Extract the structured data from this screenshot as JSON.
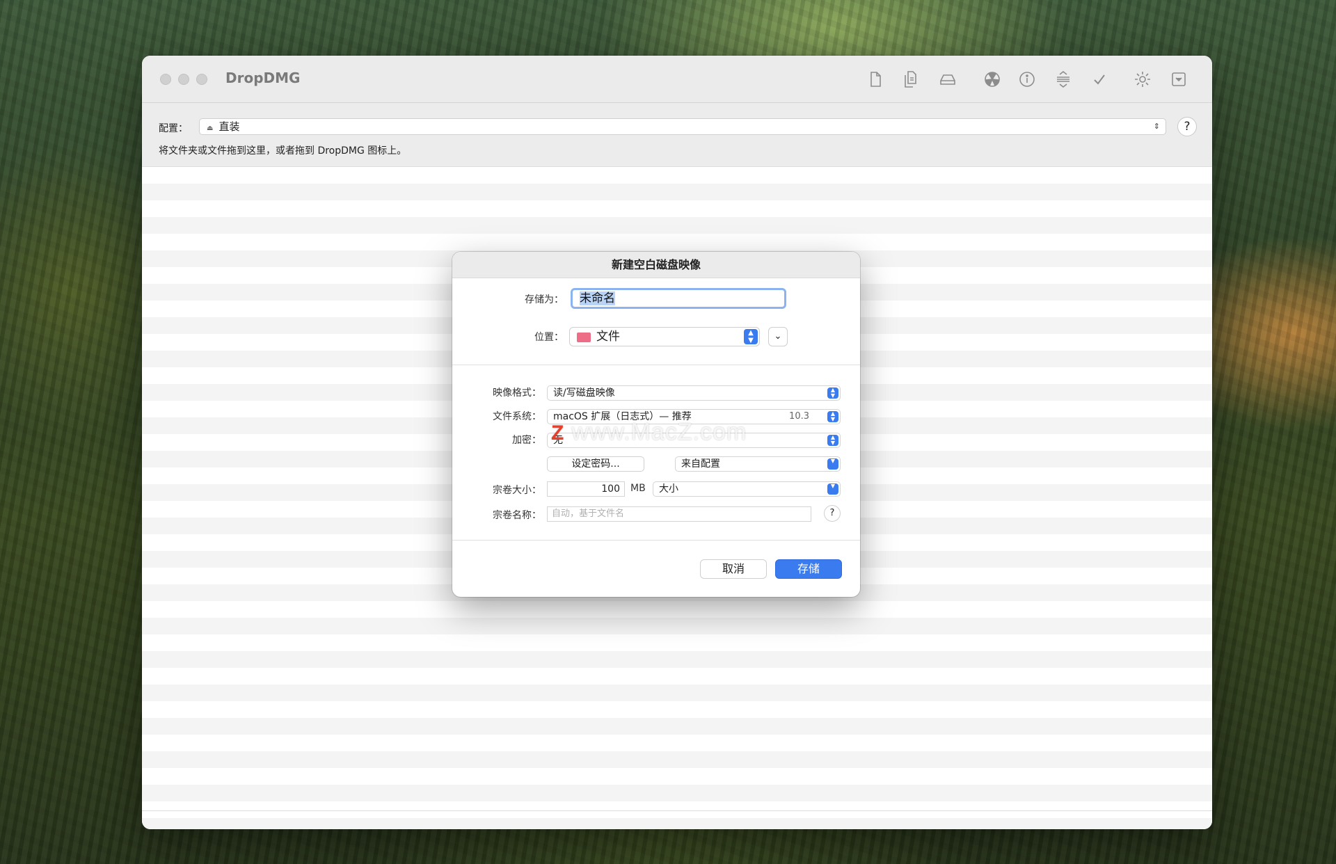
{
  "window": {
    "title": "DropDMG"
  },
  "toolbar": {
    "icons": [
      "new-file-icon",
      "copy-files-icon",
      "disk-icon",
      "radioactive-icon",
      "info-icon",
      "compress-icon",
      "checkmark-icon",
      "gear-icon",
      "dropdown-box-icon"
    ]
  },
  "config": {
    "label": "配置：",
    "selected": "直装",
    "help": "?",
    "hint": "将文件夹或文件拖到这里，或者拖到 DropDMG 图标上。"
  },
  "dialog": {
    "title": "新建空白磁盘映像",
    "save_as_label": "存储为：",
    "save_as_value": "未命名",
    "location_label": "位置：",
    "location_value": "文件",
    "image_format_label": "映像格式：",
    "image_format_value": "读/写磁盘映像",
    "filesystem_label": "文件系统：",
    "filesystem_value": "macOS 扩展（日志式）— 推荐",
    "filesystem_version": "10.3",
    "encryption_label": "加密：",
    "encryption_value": "无",
    "set_password": "设定密码...",
    "from_config": "来自配置",
    "volume_size_label": "宗卷大小：",
    "volume_size_value": "100",
    "volume_size_unit": "MB",
    "size_mode": "大小",
    "volume_name_label": "宗卷名称：",
    "volume_name_placeholder": "自动，基于文件名",
    "help": "?",
    "cancel": "取消",
    "save": "存储"
  },
  "watermark": {
    "text": "www.MacZ.com",
    "logo": "Z"
  },
  "colors": {
    "accent": "#3a7bf0",
    "folder": "#ec6d85"
  }
}
